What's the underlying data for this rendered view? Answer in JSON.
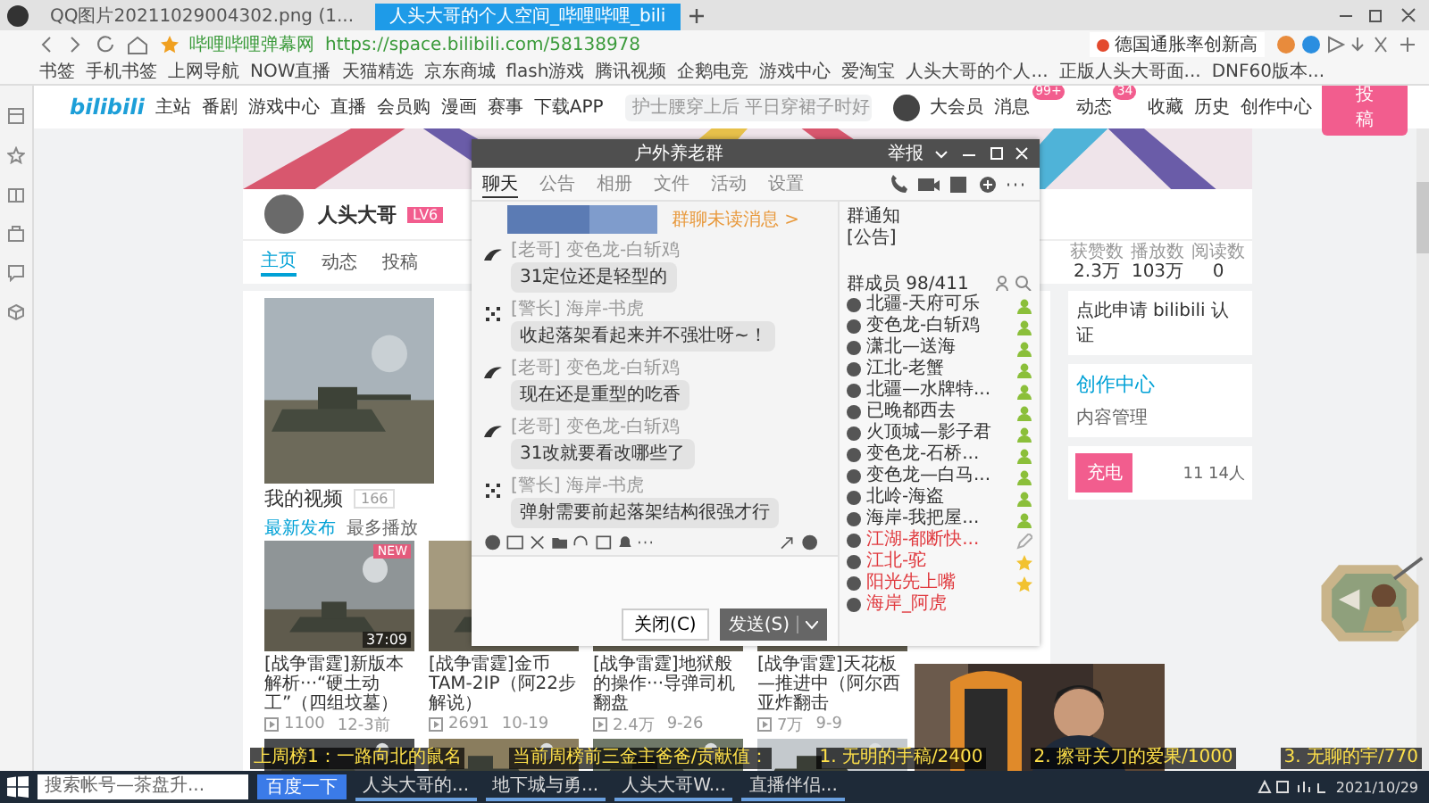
{
  "browser": {
    "tabs": [
      {
        "label": "QQ图片20211029004302.png (1...",
        "selected": false
      },
      {
        "label": "人头大哥的个人空间_哔哩哔哩_bili",
        "selected": true
      }
    ],
    "site_badge": "哔哩哔哩弹幕网",
    "url": "https://space.bilibili.com/58138978",
    "search": {
      "value": "德国通胀率创新高"
    },
    "bookmarks": [
      "书签",
      "手机书签",
      "上网导航",
      "NOW直播",
      "天猫精选",
      "京东商城",
      "flash游戏",
      "腾讯视频",
      "企鹅电竞",
      "游戏中心",
      "爱淘宝",
      "人头大哥的个人...",
      "正版人头大哥面...",
      "DNF60版本..."
    ]
  },
  "site": {
    "logo": "bilibili",
    "nav": [
      "主站",
      "番剧",
      "游戏中心",
      "直播",
      "会员购",
      "漫画",
      "赛事",
      "下载APP"
    ],
    "search": {
      "placeholder": "护士腰穿上后 平日穿裙子时好"
    },
    "user_nav": [
      {
        "label": "大会员"
      },
      {
        "label": "消息",
        "badge": "99+"
      },
      {
        "label": "动态",
        "badge": "34"
      },
      {
        "label": "收藏"
      },
      {
        "label": "历史"
      },
      {
        "label": "创作中心"
      }
    ],
    "upload_button": "投稿"
  },
  "profile": {
    "name": "人头大哥",
    "level": "LV6",
    "tabs": [
      {
        "label": "主页",
        "selected": true
      },
      {
        "label": "动态",
        "selected": false
      },
      {
        "label": "投稿",
        "selected": false
      }
    ],
    "stats": [
      {
        "label": "获赞数",
        "value": "2.3万"
      },
      {
        "label": "播放数",
        "value": "103万"
      },
      {
        "label": "阅读数",
        "value": "0"
      }
    ]
  },
  "videos": {
    "title": "我的视频",
    "count": "166",
    "sort": [
      {
        "label": "最新发布",
        "selected": true
      },
      {
        "label": "最多播放",
        "selected": false
      }
    ],
    "row_1": [
      {
        "title": "[战争雷霆]新版本解析···“硬土动工”（四组坟墓）",
        "plays": "1100",
        "date": "12-3前",
        "duration": "37:09",
        "badge": "NEW"
      },
      {
        "title": "[战争雷霆]金币TAM-2IP（阿22步解说）",
        "plays": "2691",
        "date": "10-19"
      },
      {
        "title": "[战争雷霆]地狱般的操作···导弹司机翻盘",
        "plays": "2.4万",
        "date": "9-26"
      },
      {
        "title": "[战争雷霆]天花板—推进中（阿尔西亚炸翻击",
        "plays": "7万",
        "date": "9-9"
      }
    ]
  },
  "side_cards": {
    "verify": "点此申请 bilibili 认证",
    "creator": "创作中心",
    "content": "内容管理",
    "charge_button": "充电",
    "charge_count": "11 14人"
  },
  "chat": {
    "title": "户外养老群",
    "report": "举报",
    "tabs": [
      {
        "label": "聊天",
        "selected": true
      },
      {
        "label": "公告",
        "selected": false
      },
      {
        "label": "相册",
        "selected": false
      },
      {
        "label": "文件",
        "selected": false
      },
      {
        "label": "活动",
        "selected": false
      },
      {
        "label": "设置",
        "selected": false
      }
    ],
    "unread_link": "群聊未读消息 >",
    "messages": [
      {
        "kind": "wing",
        "title": "[老哥]",
        "sender": "变色龙-白斩鸡",
        "text": "31定位还是轻型的"
      },
      {
        "kind": "dots",
        "title": "[警长]",
        "sender": "海岸-书虎",
        "text": "收起落架看起来并不强壮呀~！"
      },
      {
        "kind": "wing",
        "title": "[老哥]",
        "sender": "变色龙-白斩鸡",
        "text": "现在还是重型的吃香"
      },
      {
        "kind": "wing",
        "title": "[老哥]",
        "sender": "变色龙-白斩鸡",
        "text": "31改就要看改哪些了"
      },
      {
        "kind": "dots",
        "title": "[警长]",
        "sender": "海岸-书虎",
        "text": "弹射需要前起落架结构很强才行"
      }
    ],
    "close_button": "关闭(C)",
    "send_button": "发送(S)",
    "notice_title": "群通知",
    "notice": "[公告]",
    "members_title": "群成员 98/411",
    "members": [
      {
        "name": "北疆-天府可乐",
        "color": "#333333",
        "kind": "member"
      },
      {
        "name": "变色龙-白斩鸡",
        "color": "#333333",
        "kind": "member"
      },
      {
        "name": "潇北—送海",
        "color": "#333333",
        "kind": "member"
      },
      {
        "name": "江北-老蟹",
        "color": "#333333",
        "kind": "member"
      },
      {
        "name": "北疆—水牌特...",
        "color": "#333333",
        "kind": "member"
      },
      {
        "name": "已晚都西去",
        "color": "#333333",
        "kind": "member"
      },
      {
        "name": "火顶城—影子君",
        "color": "#333333",
        "kind": "member"
      },
      {
        "name": "变色龙-石桥...",
        "color": "#333333",
        "kind": "member"
      },
      {
        "name": "变色龙—白马...",
        "color": "#333333",
        "kind": "member"
      },
      {
        "name": "北岭-海盗",
        "color": "#333333",
        "kind": "member"
      },
      {
        "name": "海岸-我把屋...",
        "color": "#333333",
        "kind": "member"
      },
      {
        "name": "江湖-都断快...",
        "color": "#e0393e",
        "kind": "editor"
      },
      {
        "name": "江北-驼",
        "color": "#e0393e",
        "kind": "star"
      },
      {
        "name": "阳光先上嘴",
        "color": "#e0393e",
        "kind": "star"
      },
      {
        "name": "海岸_阿虎",
        "color": "#e0393e",
        "kind": "plain"
      }
    ]
  },
  "overlay": [
    "上周榜1：一路向北的鼠名",
    "当前周榜前三金主爸爸/贡献值：",
    "1. 无明的手稿/2400",
    "2. 擦哥关刀的爱果/1000",
    "3. 无聊的宇/770"
  ],
  "taskbar": {
    "search": {
      "value": "搜索帐号—茶盘升..."
    },
    "search_button": "百度一下",
    "apps": [
      "人头大哥的...",
      "地下城与勇...",
      "人头大哥W...",
      "直播伴侣..."
    ],
    "date": "2021/10/29"
  }
}
